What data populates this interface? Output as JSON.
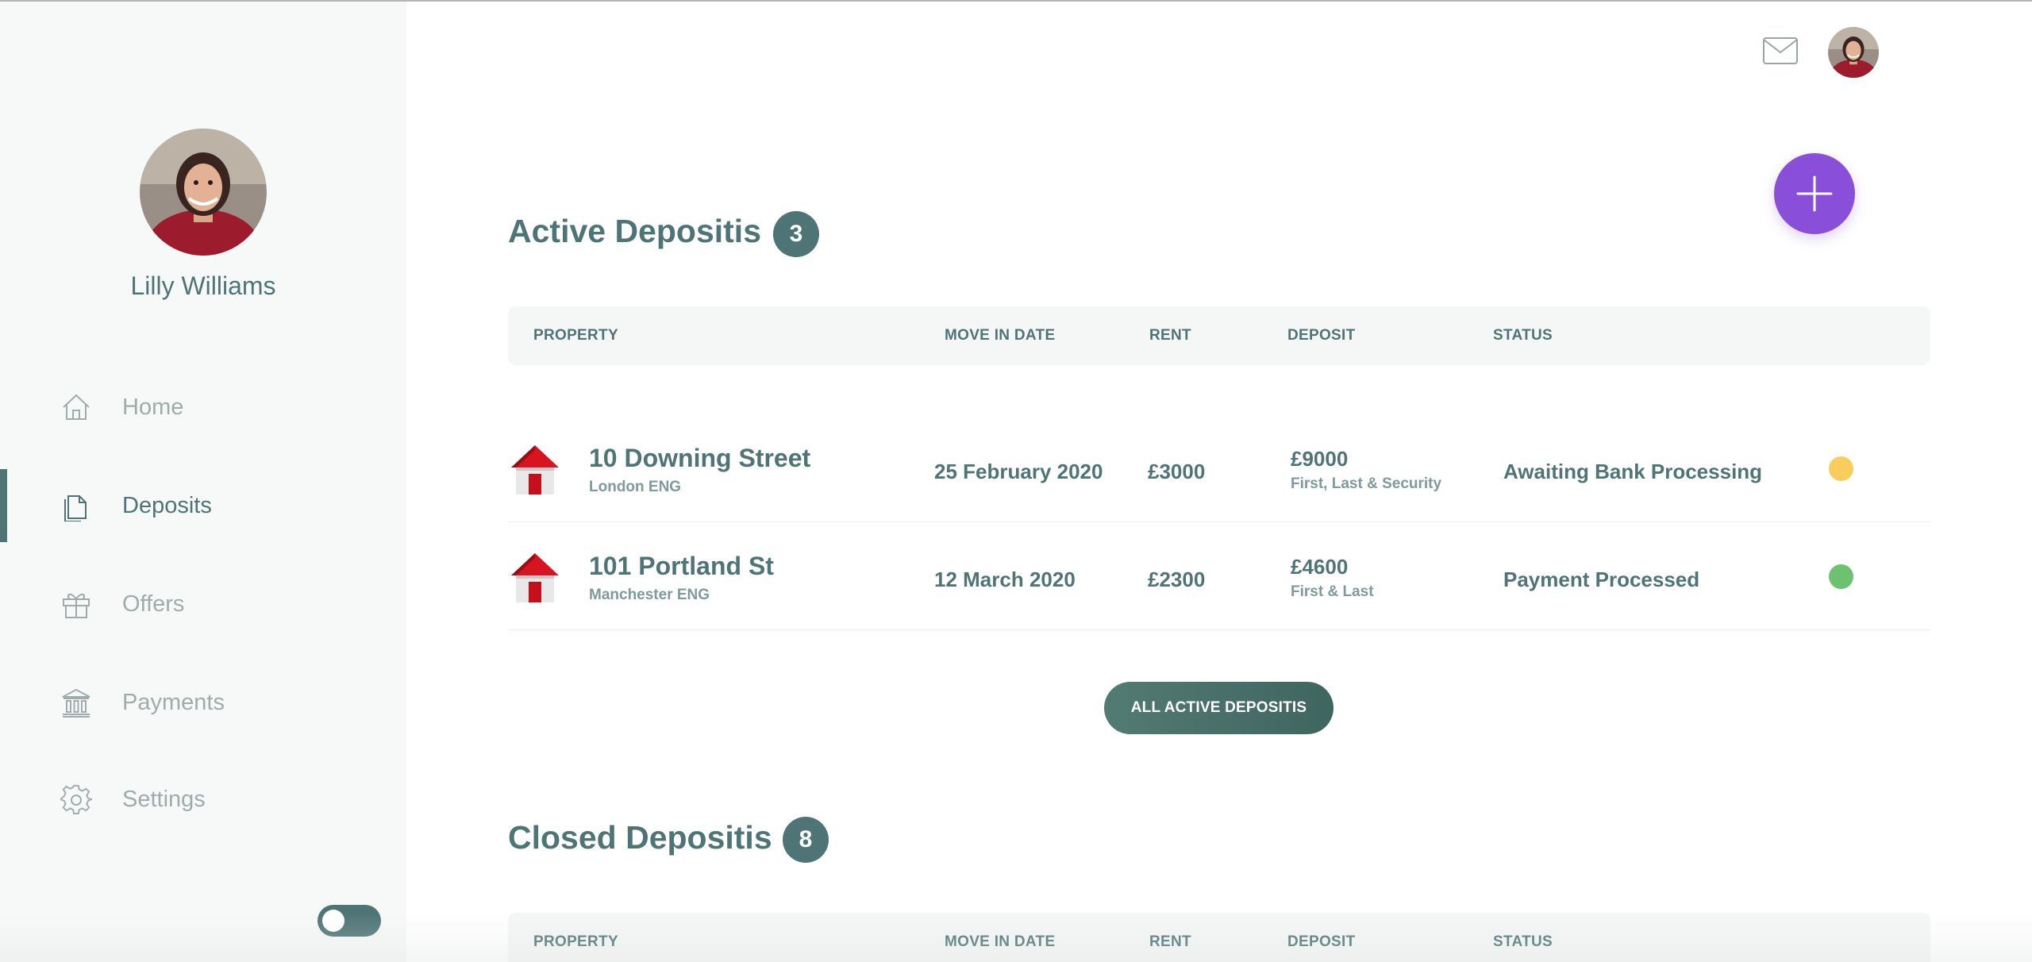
{
  "user": {
    "name": "Lilly Williams"
  },
  "sidebar": {
    "items": [
      {
        "label": "Home",
        "icon": "home-icon",
        "active": false
      },
      {
        "label": "Deposits",
        "icon": "document-icon",
        "active": true
      },
      {
        "label": "Offers",
        "icon": "gift-icon",
        "active": false
      },
      {
        "label": "Payments",
        "icon": "bank-icon",
        "active": false
      },
      {
        "label": "Settings",
        "icon": "gear-icon",
        "active": false
      }
    ],
    "toggle_on": false
  },
  "header": {
    "mail_icon": "mail-icon",
    "add_icon": "plus-icon"
  },
  "active": {
    "title": "Active Depositis",
    "count": "3",
    "columns": [
      "PROPERTY",
      "MOVE IN DATE",
      "RENT",
      "DEPOSIT",
      "STATUS"
    ],
    "rows": [
      {
        "name": "10 Downing Street",
        "location": "London ENG",
        "date": "25 February 2020",
        "rent": "£3000",
        "deposit": "£9000",
        "deposit_note": "First, Last & Security",
        "status": "Awaiting Bank Processing",
        "status_color": "#f9cd5b"
      },
      {
        "name": "101 Portland St",
        "location": "Manchester ENG",
        "date": "12 March 2020",
        "rent": "£2300",
        "deposit": "£4600",
        "deposit_note": "First & Last",
        "status": "Payment Processed",
        "status_color": "#6cc26f"
      }
    ],
    "button_label": "ALL ACTIVE DEPOSITIS"
  },
  "closed": {
    "title": "Closed Depositis",
    "count": "8",
    "columns": [
      "PROPERTY",
      "MOVE IN DATE",
      "RENT",
      "DEPOSIT",
      "STATUS"
    ]
  },
  "colors": {
    "accent": "#4f7476",
    "fab": "#8a4fd8",
    "sidebar_bg": "#f7f8f8"
  }
}
